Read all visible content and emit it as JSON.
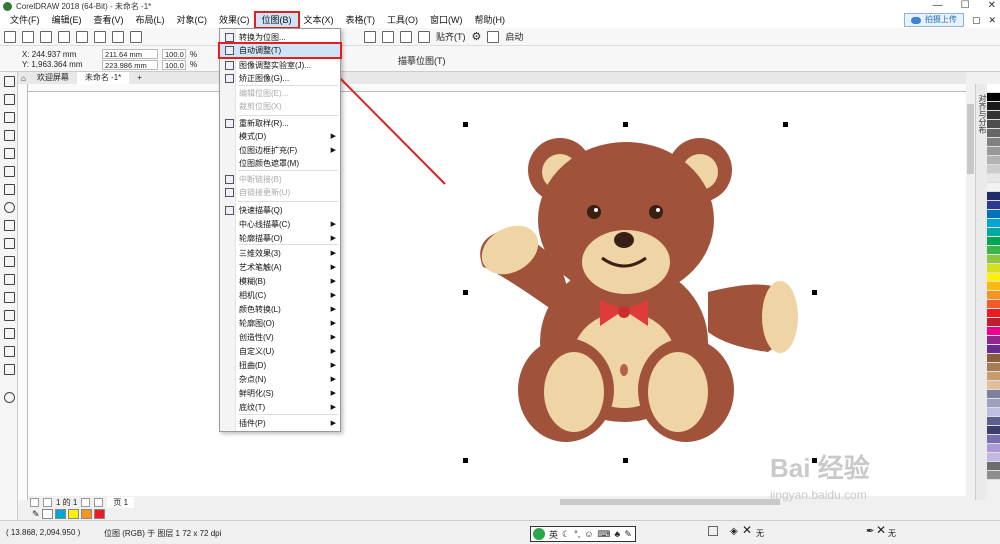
{
  "window": {
    "title": "CorelDRAW 2018 (64-Bit) - 未命名 -1*",
    "controls": [
      "—",
      "☐",
      "✕"
    ]
  },
  "menu": {
    "items": [
      "文件(F)",
      "编辑(E)",
      "查看(V)",
      "布局(L)",
      "对象(C)",
      "效果(C)",
      "位图(B)",
      "文本(X)",
      "表格(T)",
      "工具(O)",
      "窗口(W)",
      "帮助(H)"
    ],
    "active_index": 6,
    "upload_label": "拍摄上传"
  },
  "toolbar1": {
    "align_label": "贴齐(T)",
    "launch_label": "启动"
  },
  "toolbar2": {
    "x": "X: 244.937 mm",
    "y": "Y: 1,963.364 mm",
    "w": "211.64 mm",
    "h": "223.986 mm",
    "sx": "100.0",
    "sy": "100.0",
    "pct": "%",
    "trace_label": "描摹位图(T)"
  },
  "doc_tabs": {
    "welcome": "欢迎屏幕",
    "current": "未命名 -1*",
    "add": "+"
  },
  "bitmap_menu": [
    {
      "label": "转换为位图...",
      "state": "normal",
      "submenu": false,
      "icon": "convert-to-bitmap-icon"
    },
    {
      "label": "自动调整(T)",
      "state": "highlighted",
      "submenu": false,
      "icon": "auto-adjust-icon"
    },
    {
      "label": "图像调整实验室(J)...",
      "state": "normal",
      "submenu": false,
      "icon": "image-adjust-lab-icon"
    },
    {
      "label": "矫正图像(G)...",
      "state": "normal",
      "submenu": false,
      "icon": "straighten-image-icon"
    },
    {
      "label": "编辑位图(E)...",
      "state": "disabled",
      "submenu": false,
      "icon": ""
    },
    {
      "label": "裁剪位图(X)",
      "state": "disabled",
      "submenu": false,
      "icon": ""
    },
    {
      "label": "重新取样(R)...",
      "state": "normal",
      "submenu": false,
      "icon": "resample-icon"
    },
    {
      "label": "模式(D)",
      "state": "normal",
      "submenu": true,
      "icon": ""
    },
    {
      "label": "位图边框扩充(F)",
      "state": "normal",
      "submenu": true,
      "icon": ""
    },
    {
      "label": "位图颜色遮罩(M)",
      "state": "normal",
      "submenu": false,
      "icon": ""
    },
    {
      "label": "中断链接(B)",
      "state": "disabled",
      "submenu": false,
      "icon": "break-link-icon"
    },
    {
      "label": "自链接更新(U)",
      "state": "disabled",
      "submenu": false,
      "icon": "update-link-icon"
    },
    {
      "label": "快速描摹(Q)",
      "state": "normal",
      "submenu": false,
      "icon": "quick-trace-icon"
    },
    {
      "label": "中心线描摹(C)",
      "state": "normal",
      "submenu": true,
      "icon": ""
    },
    {
      "label": "轮廓描摹(O)",
      "state": "normal",
      "submenu": true,
      "icon": ""
    },
    {
      "label": "三维效果(3)",
      "state": "normal",
      "submenu": true,
      "icon": ""
    },
    {
      "label": "艺术笔触(A)",
      "state": "normal",
      "submenu": true,
      "icon": ""
    },
    {
      "label": "模糊(B)",
      "state": "normal",
      "submenu": true,
      "icon": ""
    },
    {
      "label": "相机(C)",
      "state": "normal",
      "submenu": true,
      "icon": ""
    },
    {
      "label": "颜色转换(L)",
      "state": "normal",
      "submenu": true,
      "icon": ""
    },
    {
      "label": "轮廓图(O)",
      "state": "normal",
      "submenu": true,
      "icon": ""
    },
    {
      "label": "创造性(V)",
      "state": "normal",
      "submenu": true,
      "icon": ""
    },
    {
      "label": "自定义(U)",
      "state": "normal",
      "submenu": true,
      "icon": ""
    },
    {
      "label": "扭曲(D)",
      "state": "normal",
      "submenu": true,
      "icon": ""
    },
    {
      "label": "杂点(N)",
      "state": "normal",
      "submenu": true,
      "icon": ""
    },
    {
      "label": "鲜明化(S)",
      "state": "normal",
      "submenu": true,
      "icon": ""
    },
    {
      "label": "底纹(T)",
      "state": "normal",
      "submenu": true,
      "icon": ""
    },
    {
      "label": "插件(P)",
      "state": "normal",
      "submenu": true,
      "icon": ""
    }
  ],
  "side_panel": {
    "label": "对齐与分布"
  },
  "palette": [
    "#ffffff",
    "#000000",
    "#1a1a1a",
    "#333333",
    "#4d4d4d",
    "#666666",
    "#808080",
    "#999999",
    "#b3b3b3",
    "#cccccc",
    "#e6e6e6",
    "#f2f2f2",
    "#1f2a6b",
    "#2b3990",
    "#0072bc",
    "#00a6d6",
    "#00a99d",
    "#00a651",
    "#39b54a",
    "#8dc63f",
    "#d7df23",
    "#fff200",
    "#fdb913",
    "#f7941d",
    "#f15a29",
    "#ed1c24",
    "#be1e2d",
    "#ec008c",
    "#92278f",
    "#662d91",
    "#8b5e3c",
    "#a67c52",
    "#c69c6d",
    "#dfc09b",
    "#7f7f9f",
    "#9f9fbf",
    "#bfbfdf",
    "#5f5f8f",
    "#3f3f6f",
    "#7a6fae",
    "#a99bd4",
    "#c4b8e3",
    "#6d6d6d",
    "#8e8e8e"
  ],
  "pager": {
    "page_of": "1 的 1",
    "page_tab": "页 1"
  },
  "color_bar": [
    "#00a6d6",
    "#fff200",
    "#f7941d",
    "#ed1c24"
  ],
  "status": {
    "coords": "( 13.868, 2,094.950 )",
    "object_info": "位图 (RGB) 于 图层 1 72 x 72 dpi",
    "ime": "英",
    "fill_none": "无",
    "outline_none": "无"
  },
  "watermark": {
    "brand": "Bai 经验",
    "url": "jingyan.baidu.com"
  }
}
